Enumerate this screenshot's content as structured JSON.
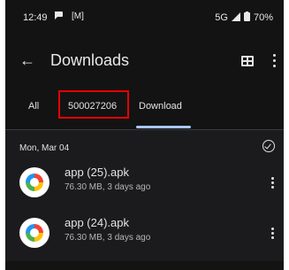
{
  "status_bar": {
    "time": "12:49",
    "network": "5G",
    "battery": "70%"
  },
  "app_bar": {
    "title": "Downloads",
    "back_icon": "arrow-back-icon",
    "view_icon": "grid-view-icon",
    "menu_icon": "more-vert-icon"
  },
  "tabs": [
    {
      "label": "All"
    },
    {
      "label": "500027206",
      "highlighted": true
    },
    {
      "label": "Download",
      "selected": true
    }
  ],
  "section": {
    "date": "Mon, Mar 04"
  },
  "files": [
    {
      "name": "app (25).apk",
      "meta": "76.30 MB, 3 days ago"
    },
    {
      "name": "app (24).apk",
      "meta": "76.30 MB, 3 days ago"
    }
  ],
  "colors": {
    "background": "#131314",
    "tab_indicator": "#a8c7fa",
    "highlight_box": "#e60000"
  }
}
